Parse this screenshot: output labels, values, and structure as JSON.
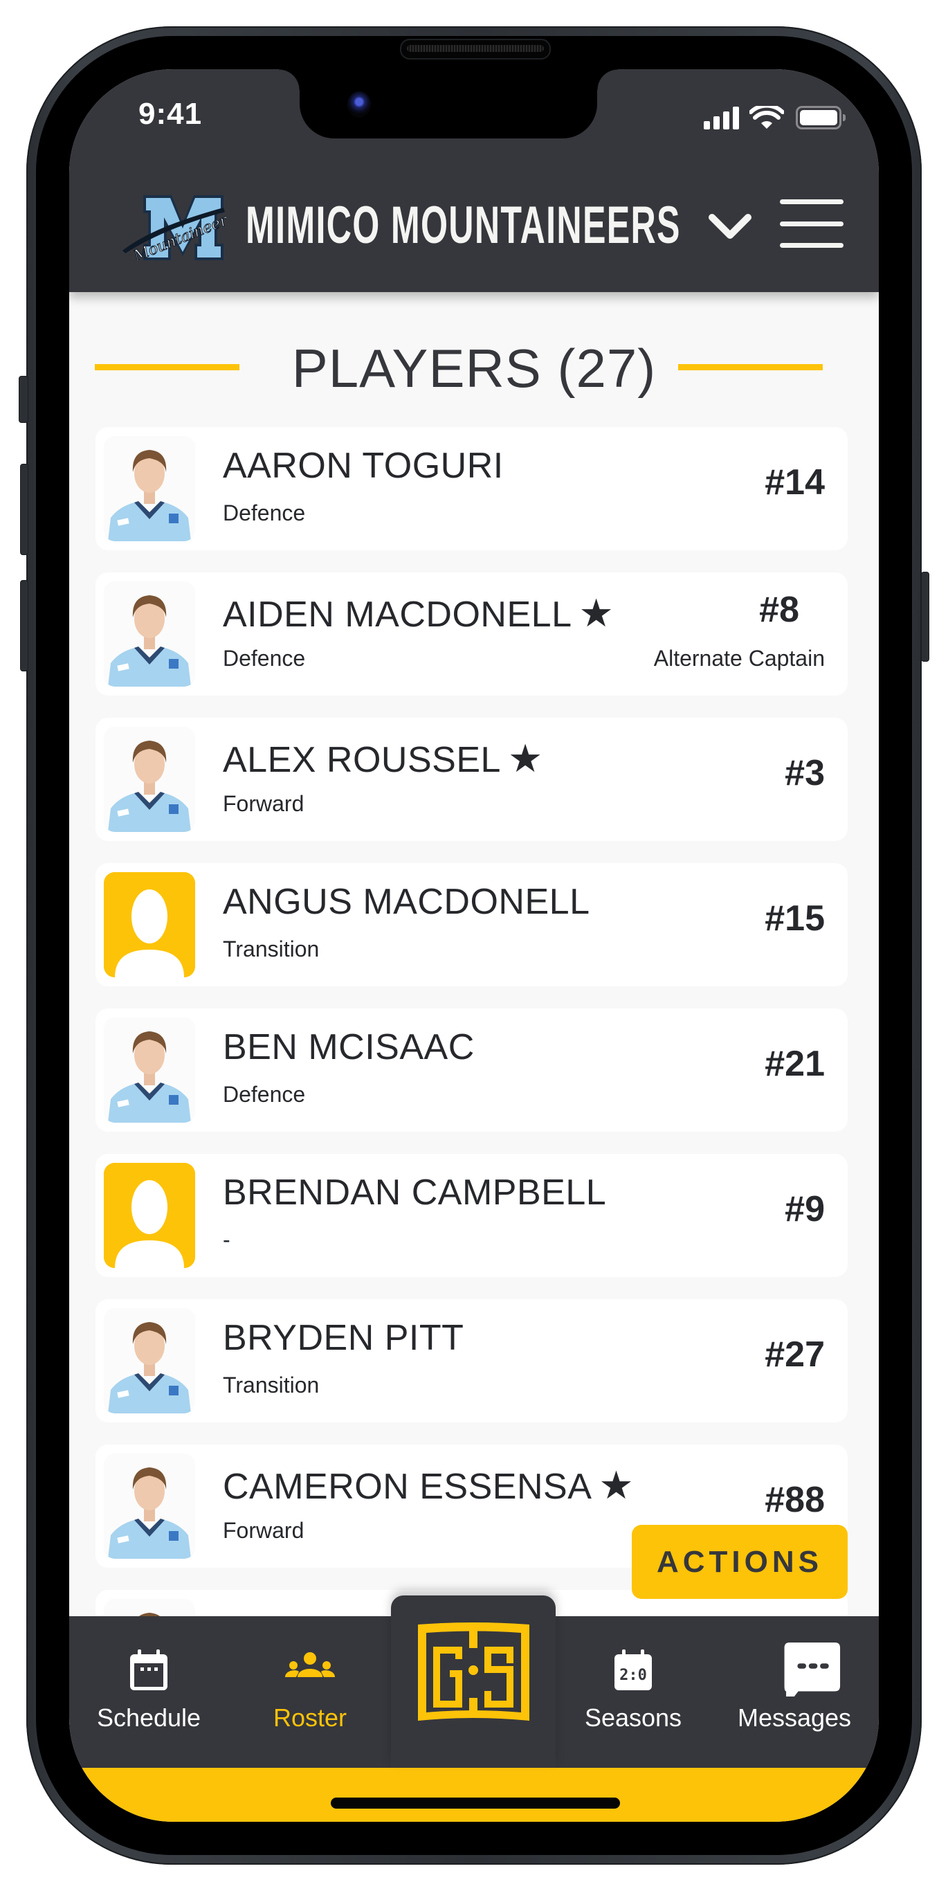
{
  "status_bar": {
    "time": "9:41",
    "icons": [
      "cellular-signal-icon",
      "wifi-icon",
      "battery-icon"
    ]
  },
  "header": {
    "team_name": "MIMICO MOUNTAINEERS",
    "logo": "mimico-mountaineers-logo",
    "logo_script": "Mountaineers",
    "logo_letter": "M",
    "dropdown_icon": "chevron-down-icon",
    "menu_icon": "hamburger-menu-icon"
  },
  "section": {
    "title": "PLAYERS (27)"
  },
  "players": [
    {
      "name": "AARON TOGURI",
      "position": "Defence",
      "number": "#14",
      "starred": false,
      "role": "",
      "photo": "photo"
    },
    {
      "name": "AIDEN MACDONELL",
      "position": "Defence",
      "number": "#8",
      "starred": true,
      "role": "Alternate Captain",
      "photo": "photo"
    },
    {
      "name": "ALEX ROUSSEL",
      "position": "Forward",
      "number": "#3",
      "starred": true,
      "role": "",
      "photo": "photo"
    },
    {
      "name": "ANGUS MACDONELL",
      "position": "Transition",
      "number": "#15",
      "starred": false,
      "role": "",
      "photo": "placeholder"
    },
    {
      "name": "BEN MCISAAC",
      "position": "Defence",
      "number": "#21",
      "starred": false,
      "role": "",
      "photo": "photo"
    },
    {
      "name": "BRENDAN CAMPBELL",
      "position": "-",
      "number": "#9",
      "starred": false,
      "role": "",
      "photo": "placeholder"
    },
    {
      "name": "BRYDEN PITT",
      "position": "Transition",
      "number": "#27",
      "starred": false,
      "role": "",
      "photo": "photo"
    },
    {
      "name": "CAMERON ESSENSA",
      "position": "Forward",
      "number": "#88",
      "starred": true,
      "role": "",
      "photo": "photo"
    },
    {
      "name": "",
      "position": "",
      "number": "",
      "starred": false,
      "role": "",
      "photo": "photo"
    }
  ],
  "star_glyph": "★",
  "actions_button": {
    "label": "ACTIONS"
  },
  "tab_bar": {
    "tabs": [
      {
        "label": "Schedule",
        "icon": "calendar-icon",
        "active": false
      },
      {
        "label": "Roster",
        "icon": "team-icon",
        "active": true
      },
      {
        "label": "",
        "icon": "gamesheet-logo-icon",
        "active": false,
        "center_logo_text": "G:S"
      },
      {
        "label": "Seasons",
        "icon": "scoreboard-calendar-icon",
        "active": false
      },
      {
        "label": "Messages",
        "icon": "chat-bubble-icon",
        "active": false
      }
    ]
  },
  "colors": {
    "header_bg": "#36373c",
    "accent_yellow": "#fdc309",
    "page_bg": "#f8f8f8",
    "card_bg": "#ffffff",
    "text_dark": "#26282c",
    "jersey_blue": "#a6d3ef"
  }
}
